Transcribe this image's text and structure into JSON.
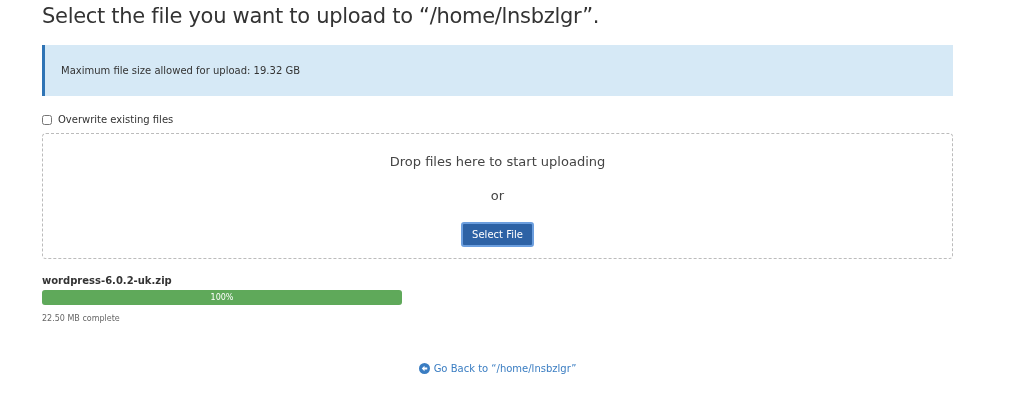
{
  "title": "Select the file you want to upload to “/home/lnsbzlgr”.",
  "notice": "Maximum file size allowed for upload: 19.32 GB",
  "overwrite": {
    "label": "Overwrite existing files",
    "checked": false
  },
  "dropzone": {
    "text": "Drop files here to start uploading",
    "or": "or",
    "button": "Select File"
  },
  "uploads": [
    {
      "name": "wordpress-6.0.2-uk.zip",
      "level": 1,
      "percent": "100%",
      "status": "22.50 MB complete"
    }
  ],
  "back_link": "Go Back to “/home/lnsbzlgr”"
}
